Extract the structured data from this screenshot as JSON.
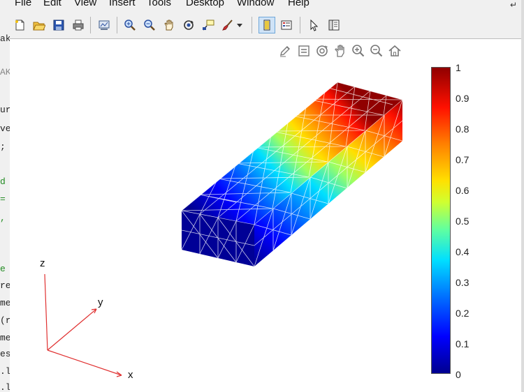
{
  "editor": {
    "fragments": [
      "ak",
      "AK",
      "ur",
      "ve",
      ";",
      "d",
      "=",
      ",",
      "e",
      "re",
      "me",
      "(r",
      "me",
      "es",
      ".l",
      ".l"
    ]
  },
  "menu": [
    "File",
    "Edit",
    "View",
    "Insert",
    "Tools",
    "Desktop",
    "Window",
    "Help"
  ],
  "toolbar_icons": [
    "new-figure-icon",
    "open-file-icon",
    "save-icon",
    "print-icon",
    "link-plot-icon",
    "zoom-in-icon",
    "zoom-out-icon",
    "pan-icon",
    "rotate-3d-icon",
    "data-cursor-icon",
    "brush-icon",
    "brush-dropdown-icon",
    "colorbar-toggle-icon",
    "legend-toggle-icon",
    "edit-plot-icon",
    "property-inspector-icon"
  ],
  "axes_toolbar_icons": [
    "brush-data-icon",
    "datatip-icon",
    "rotate-icon",
    "pan-icon",
    "zoom-in-icon",
    "zoom-out-icon",
    "restore-view-icon"
  ],
  "colorbar": {
    "ticks": [
      "1",
      "0.9",
      "0.8",
      "0.7",
      "0.6",
      "0.5",
      "0.4",
      "0.3",
      "0.2",
      "0.1",
      "0"
    ],
    "colormap": "jet",
    "range": [
      0,
      1
    ]
  },
  "triad": {
    "x": "x",
    "y": "y",
    "z": "z",
    "color": "#e03030"
  }
}
